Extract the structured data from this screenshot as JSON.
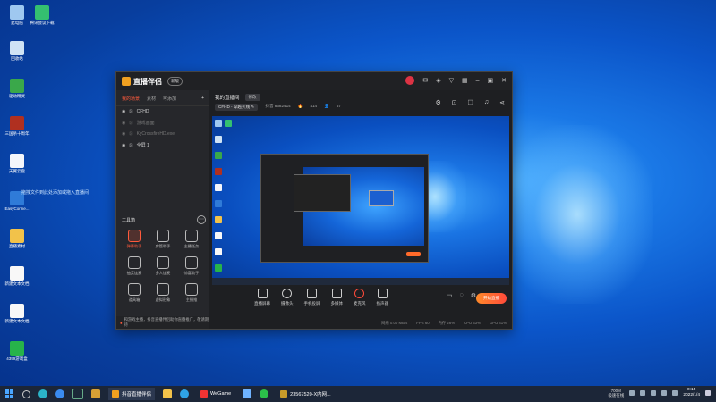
{
  "desktop": {
    "icons": [
      {
        "label": "此电脑",
        "color": "#9fc8f0"
      },
      {
        "label": "腾讯会议下载",
        "color": "#34c070"
      },
      {
        "label": "回收站",
        "color": "#cfe3f5"
      },
      {
        "label": "驱动精灵",
        "color": "#3aa84a"
      },
      {
        "label": "三国杀十周年",
        "color": "#b03020"
      },
      {
        "label": "天翼云盘",
        "color": "#f4f6fb"
      },
      {
        "label": "EasyConne...",
        "color": "#2f7bd8"
      },
      {
        "label": "直播素材",
        "color": "#f2c24a"
      },
      {
        "label": "新建文本文档",
        "color": "#f8f8f8"
      },
      {
        "label": "新建文本文档",
        "color": "#f8f8f8"
      },
      {
        "label": "4399游戏盒",
        "color": "#27b34a"
      }
    ],
    "drag_hint": "拖拽文件到此处添加或拖入直播间"
  },
  "window": {
    "app_name": "直播伴侣",
    "version_badge": "新版",
    "titlebar_icons": [
      "avatar",
      "message-icon",
      "shirt-icon",
      "filter-icon",
      "grid-icon",
      "minimize-icon",
      "maximize-icon",
      "close-icon"
    ],
    "sidebar": {
      "tabs": [
        "我的场景",
        "素材",
        "可添加"
      ],
      "active_tab": 0,
      "scenes": [
        {
          "name": "CFHD",
          "dim": false
        },
        {
          "name": "游戏画面",
          "dim": true
        },
        {
          "name": "KyCrossfireHD.exe",
          "dim": true
        },
        {
          "name": "全屏 1",
          "dim": false
        }
      ],
      "tools_title": "工具箱",
      "tools": [
        {
          "label": "弹幕助手",
          "hot": true
        },
        {
          "label": "房管助手",
          "hot": false
        },
        {
          "label": "主播任务",
          "hot": false
        },
        {
          "label": "抽奖连麦",
          "hot": false
        },
        {
          "label": "多人连麦",
          "hot": false
        },
        {
          "label": "惊喜助手",
          "hot": false
        },
        {
          "label": "道具箱",
          "hot": false
        },
        {
          "label": "虚拟形象",
          "hot": false
        },
        {
          "label": "主播推",
          "hot": false
        }
      ],
      "notice": "和游戏主播，抖音直播伴侣助你直播推广，敬请期待"
    },
    "main": {
      "room_title": "我的直播间",
      "room_btn": "修改",
      "game_pill": "CFHD - 穿越火线 ✎",
      "room_id": "抖音 8682414",
      "heat": "414",
      "viewers": "67",
      "icons": [
        "settings-icon",
        "lock-icon",
        "gift-icon",
        "bell-icon",
        "share-icon"
      ],
      "controls": [
        "直播屏幕",
        "摄像头",
        "手机投屏",
        "多媒体",
        "麦克风",
        "扬声器"
      ],
      "go_live": "开始直播",
      "status": [
        "网络 0.00 MB/s",
        "FPS 60",
        "内存 26%",
        "CPU 33%",
        "GPU 41%"
      ]
    }
  },
  "taskbar": {
    "active_app": "抖音直播伴侣",
    "other_apps": [
      "WeGame",
      "23567520-X内网..."
    ],
    "network": {
      "speed": "700M",
      "label": "极速在线"
    },
    "time": "0:15",
    "date": "2022/1/4"
  }
}
